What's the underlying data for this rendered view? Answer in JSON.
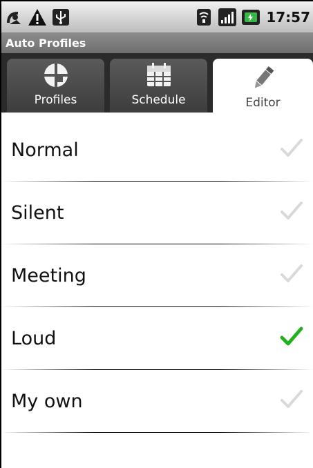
{
  "status_bar": {
    "time": "17:57",
    "left_icons": [
      "satellite-icon",
      "warning-icon",
      "usb-icon"
    ],
    "right_icons": [
      "wifi-icon",
      "signal-icon",
      "battery-icon"
    ]
  },
  "title": "Auto Profiles",
  "tabs": [
    {
      "label": "Profiles",
      "icon": "profiles-icon",
      "active": false
    },
    {
      "label": "Schedule",
      "icon": "calendar-icon",
      "active": false
    },
    {
      "label": "Editor",
      "icon": "pencil-icon",
      "active": true
    }
  ],
  "profiles": [
    {
      "label": "Normal",
      "checked": false
    },
    {
      "label": "Silent",
      "checked": false
    },
    {
      "label": "Meeting",
      "checked": false
    },
    {
      "label": "Loud",
      "checked": true
    },
    {
      "label": "My own",
      "checked": false
    }
  ],
  "colors": {
    "check_active": "#22b01c",
    "check_inactive": "#d9d9d9"
  }
}
